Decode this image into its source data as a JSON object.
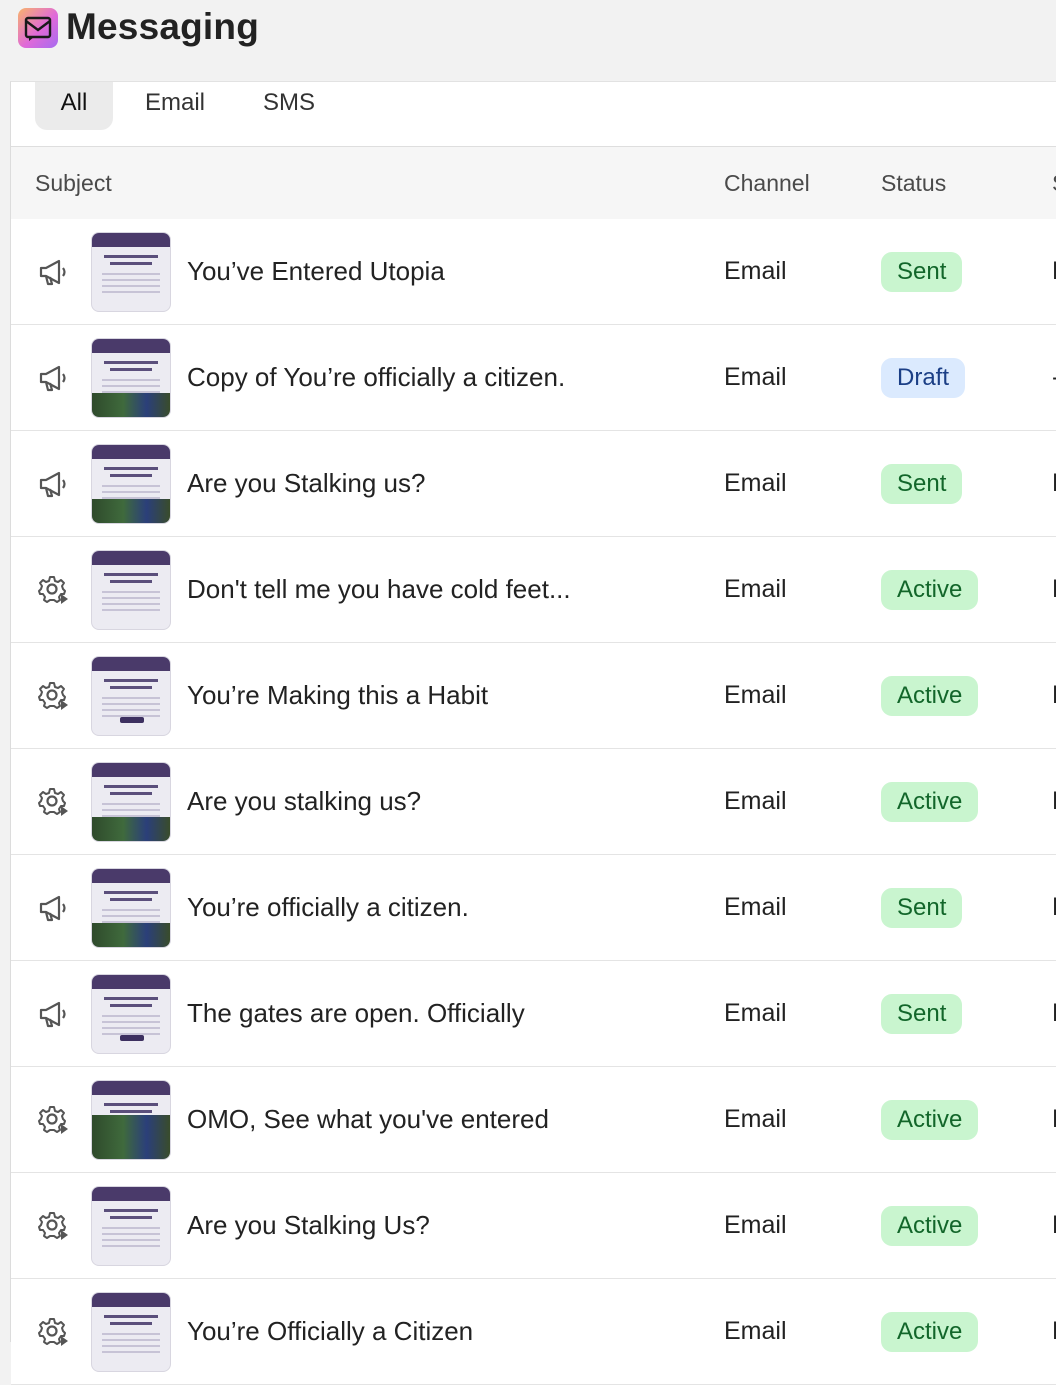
{
  "app": {
    "title": "Messaging",
    "icon": "mail-app-icon"
  },
  "tabs": [
    {
      "label": "All",
      "active": true
    },
    {
      "label": "Email",
      "active": false
    },
    {
      "label": "SMS",
      "active": false
    }
  ],
  "table": {
    "headers": {
      "subject": "Subject",
      "channel": "Channel",
      "status": "Status",
      "extra": "S"
    },
    "rows": [
      {
        "type": "campaign",
        "icon": "megaphone-icon",
        "subject": "You’ve Entered Utopia",
        "channel": "Email",
        "status": "Sent",
        "extra": "F"
      },
      {
        "type": "campaign",
        "icon": "megaphone-icon",
        "subject": "Copy of You’re officially a citizen.",
        "channel": "Email",
        "status": "Draft",
        "extra": "-"
      },
      {
        "type": "campaign",
        "icon": "megaphone-icon",
        "subject": "Are you Stalking us?",
        "channel": "Email",
        "status": "Sent",
        "extra": "F"
      },
      {
        "type": "automation",
        "icon": "gear-icon",
        "subject": "Don't tell me you have cold feet...",
        "channel": "Email",
        "status": "Active",
        "extra": "F"
      },
      {
        "type": "automation",
        "icon": "gear-icon",
        "subject": "You’re Making this a Habit",
        "channel": "Email",
        "status": "Active",
        "extra": "F"
      },
      {
        "type": "automation",
        "icon": "gear-icon",
        "subject": "Are you stalking us?",
        "channel": "Email",
        "status": "Active",
        "extra": "F"
      },
      {
        "type": "campaign",
        "icon": "megaphone-icon",
        "subject": "You’re officially a citizen.",
        "channel": "Email",
        "status": "Sent",
        "extra": "F"
      },
      {
        "type": "campaign",
        "icon": "megaphone-icon",
        "subject": "The gates are open. Officially",
        "channel": "Email",
        "status": "Sent",
        "extra": "F"
      },
      {
        "type": "automation",
        "icon": "gear-icon",
        "subject": "OMO, See what you've entered",
        "channel": "Email",
        "status": "Active",
        "extra": "F"
      },
      {
        "type": "automation",
        "icon": "gear-icon",
        "subject": "Are you Stalking Us?",
        "channel": "Email",
        "status": "Active",
        "extra": "F"
      },
      {
        "type": "automation",
        "icon": "gear-icon",
        "subject": "You’re Officially a Citizen",
        "channel": "Email",
        "status": "Active",
        "extra": "F"
      }
    ]
  }
}
